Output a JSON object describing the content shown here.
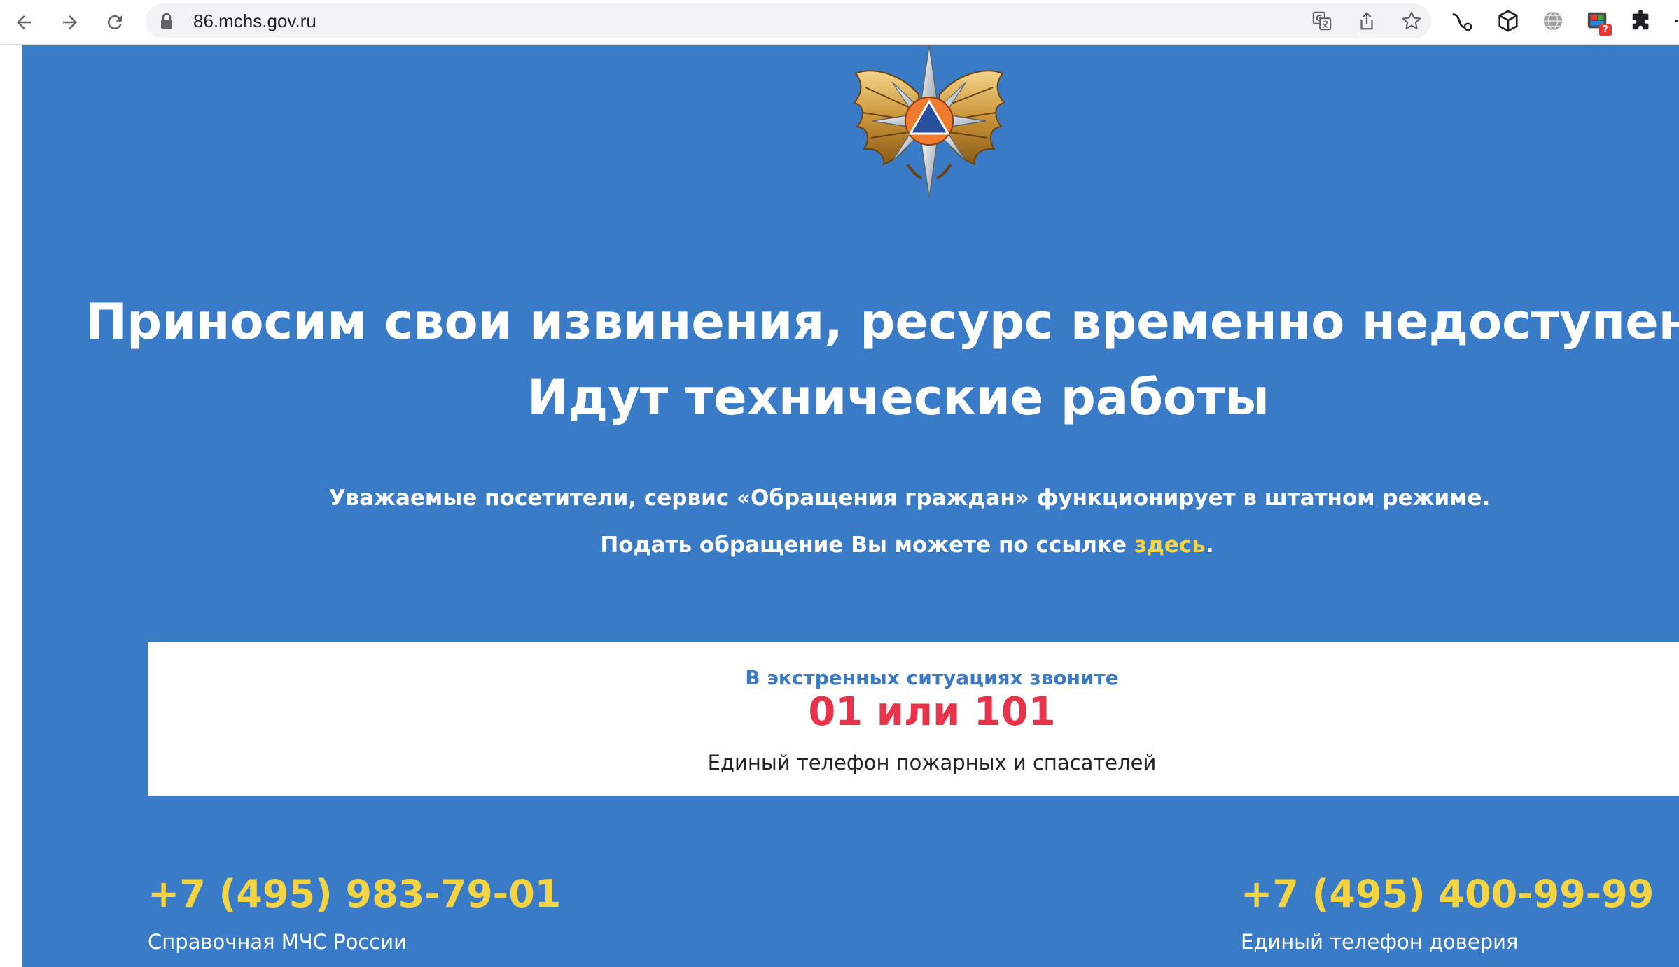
{
  "browser": {
    "url": "86.mchs.gov.ru",
    "extension_badge": "?"
  },
  "main": {
    "headline_line1": "Приносим свои извинения, ресурс временно недоступен.",
    "headline_line2": "Идут технические работы",
    "notice_line1": "Уважаемые посетители, сервис «Обращения граждан» функционирует в штатном режиме.",
    "notice_line2_before": "Подать обращение Вы можете по ссылке ",
    "notice_link": "здесь",
    "notice_line2_after": "."
  },
  "emergency": {
    "title": "В экстренных ситуациях звоните",
    "number": "01 или 101",
    "description": "Единый телефон пожарных и спасателей"
  },
  "contacts": [
    {
      "phone": "+7 (495) 983-79-01",
      "label": "Справочная МЧС России"
    },
    {
      "phone": "+7 (495) 400-99-99",
      "label": "Единый телефон доверия"
    }
  ],
  "colors": {
    "page_blue": "#3a7bc8",
    "accent_yellow": "#f5d442",
    "emergency_red": "#e8334a"
  }
}
